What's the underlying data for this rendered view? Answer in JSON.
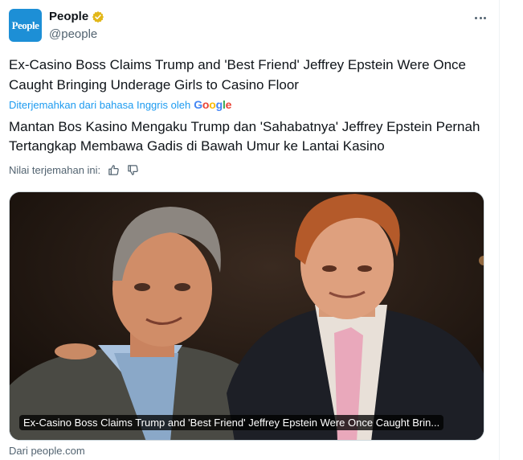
{
  "author": {
    "display_name": "People",
    "handle": "@people",
    "avatar_text": "People",
    "verified_color": "#e2b719"
  },
  "tweet": {
    "original_text": "Ex-Casino Boss Claims Trump and 'Best Friend' Jeffrey Epstein Were Once Caught Bringing Underage Girls to Casino Floor",
    "translated_by_label": "Diterjemahkan dari bahasa Inggris oleh",
    "translation_provider": "Google",
    "translated_text": "Mantan Bos Kasino Mengaku Trump dan 'Sahabatnya' Jeffrey Epstein Pernah Tertangkap Membawa Gadis di Bawah Umur ke Lantai Kasino",
    "rate_translation_label": "Nilai terjemahan ini:"
  },
  "link_card": {
    "caption": "Ex-Casino Boss Claims Trump and 'Best Friend' Jeffrey Epstein Were Once Caught Brin...",
    "source": "Dari people.com"
  },
  "colors": {
    "link_blue": "#1d9bf0",
    "secondary_text": "#536471",
    "primary_text": "#0f1419"
  },
  "icons": [
    "more-icon",
    "verified-badge-icon",
    "thumbs-up-icon",
    "thumbs-down-icon"
  ]
}
